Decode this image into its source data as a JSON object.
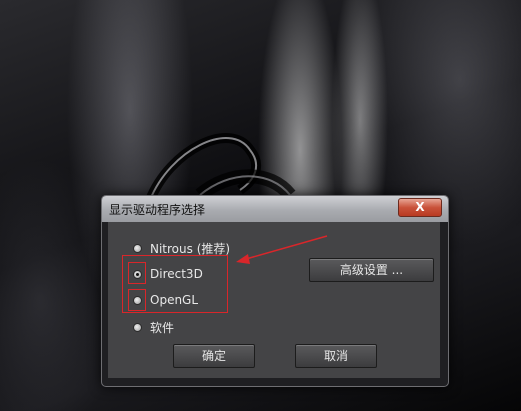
{
  "dialog": {
    "title": "显示驱动程序选择",
    "close_label": "X",
    "options": [
      {
        "label": "Nitrous (推荐)",
        "checked": false
      },
      {
        "label": "Direct3D",
        "checked": true
      },
      {
        "label": "OpenGL",
        "checked": false
      },
      {
        "label": "软件",
        "checked": false
      }
    ],
    "advanced_label": "高级设置 ...",
    "ok_label": "确定",
    "cancel_label": "取消"
  },
  "colors": {
    "annotation_red": "#d9262a",
    "dialog_client": "#444446",
    "close_button": "#c9523a"
  },
  "icons": [
    "radio-button",
    "close-icon",
    "arrow-annotation"
  ]
}
